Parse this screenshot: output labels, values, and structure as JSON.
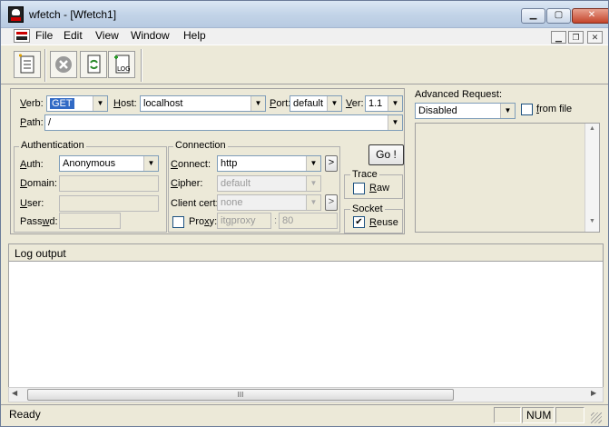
{
  "window": {
    "title": "wfetch - [Wfetch1]"
  },
  "menu": [
    "File",
    "Edit",
    "View",
    "Window",
    "Help"
  ],
  "request": {
    "verb_label": "Verb:",
    "verb": "GET",
    "host_label": "Host:",
    "host": "localhost",
    "port_label": "Port:",
    "port": "default",
    "ver_label": "Ver:",
    "ver": "1.1",
    "path_label": "Path:",
    "path": "/"
  },
  "auth": {
    "title": "Authentication",
    "auth_label": "Auth:",
    "auth": "Anonymous",
    "domain_label": "Domain:",
    "user_label": "User:",
    "passwd_label": "Passwd:"
  },
  "connection": {
    "title": "Connection",
    "connect_label": "Connect:",
    "connect": "http",
    "cipher_label": "Cipher:",
    "cipher": "default",
    "cert_label": "Client cert:",
    "cert": "none",
    "proxy_label": "Proxy:",
    "proxy": "itgproxy",
    "proxy_port": "80",
    "colon": ":",
    "more": ">"
  },
  "go_label": "Go !",
  "trace": {
    "title": "Trace",
    "raw_label": "Raw"
  },
  "socket": {
    "title": "Socket",
    "reuse_label": "Reuse",
    "check": "✔"
  },
  "advanced": {
    "label": "Advanced Request:",
    "value": "Disabled",
    "from_file_label": "from file"
  },
  "log": {
    "header": "Log output"
  },
  "scroll_grip": "III",
  "status": {
    "text": "Ready",
    "num": "NUM"
  },
  "arrow": "▼"
}
